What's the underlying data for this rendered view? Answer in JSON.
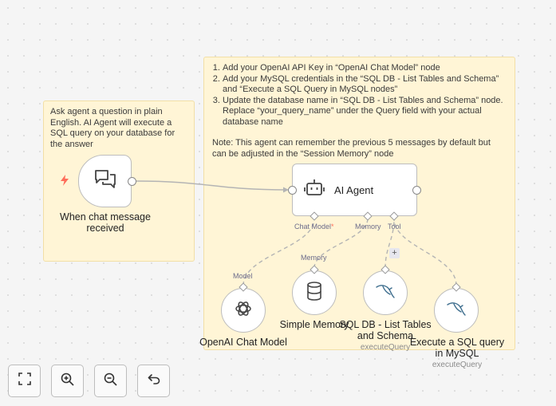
{
  "sticky_note_1": {
    "text": "Ask agent a question in plain English. AI Agent will execute a SQL query on your database for the answer"
  },
  "sticky_note_2": {
    "steps": [
      "Add your OpenAI API Key in “OpenAI Chat Model” node",
      "Add your MySQL credentials in the “SQL DB - List Tables and Schema” and “Execute a SQL Query in MySQL nodes”",
      "Update the database name in “SQL DB - List Tables and Schema” node. Replace “your_query_name” under the Query field with your actual database name"
    ],
    "note": "Note: This agent can remember the previous 5 messages by default but can be adjusted in the “Session Memory” node"
  },
  "nodes": {
    "trigger": {
      "label": "When chat message received",
      "icon": "chat-bubbles-icon",
      "badge_icon": "lightning-icon"
    },
    "agent": {
      "label": "AI Agent",
      "icon": "robot-icon"
    },
    "openai": {
      "label": "OpenAI Chat Model",
      "icon": "openai-icon"
    },
    "memory": {
      "label": "Simple Memory",
      "icon": "database-icon"
    },
    "sqldb": {
      "label": "SQL DB - List Tables and Schema",
      "sublabel": "executeQuery",
      "icon": "mysql-icon"
    },
    "exec": {
      "label": "Execute a SQL query in MySQL",
      "sublabel": "executeQuery",
      "icon": "mysql-icon"
    }
  },
  "handles": {
    "chat_model": "Chat Model",
    "required_mark": "*",
    "memory": "Memory",
    "tool": "Tool",
    "model_input": "Model",
    "memory_input": "Memory"
  },
  "controls": [
    {
      "name": "fit-view",
      "icon": "expand-icon"
    },
    {
      "name": "zoom-in",
      "icon": "zoom-in-icon"
    },
    {
      "name": "zoom-out",
      "icon": "zoom-out-icon"
    },
    {
      "name": "undo",
      "icon": "undo-icon"
    }
  ],
  "colors": {
    "sticky_bg": "#fff5d6",
    "trigger_bolt": "#ff6d5a",
    "required": "#ff6d5a",
    "connection": "#b4b4b4"
  }
}
